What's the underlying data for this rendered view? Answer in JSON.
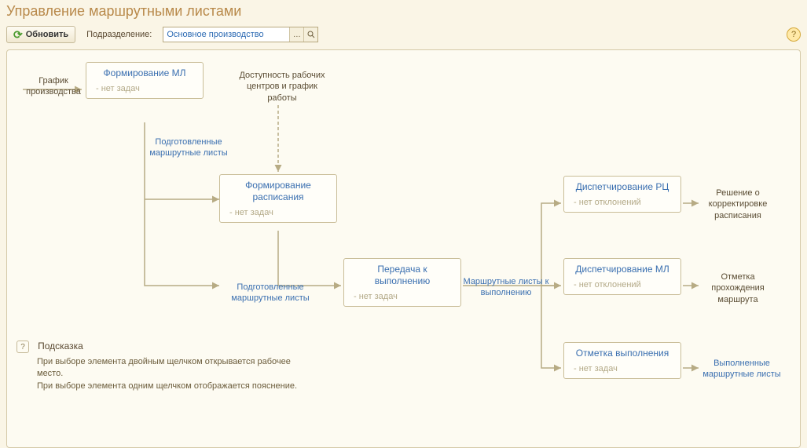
{
  "title": "Управление маршрутными листами",
  "toolbar": {
    "refresh_label": "Обновить",
    "dept_label": "Подразделение:",
    "dept_value": "Основное производство"
  },
  "labels": {
    "schedule_input": "График производства",
    "availability": "Доступность рабочих центров и график работы",
    "prepared_sheets_1": "Подготовленные маршрутные листы",
    "prepared_sheets_2": "Подготовленные маршрутные листы",
    "sheets_to_exec": "Маршрутные листы к выполнению",
    "decision": "Решение о корректировке расписания",
    "route_mark": "Отметка прохождения маршрута",
    "done_sheets": "Выполненные маршрутные листы"
  },
  "nodes": {
    "form_ml": {
      "title": "Формирование МЛ",
      "sub": "- нет задач"
    },
    "form_sched": {
      "title": "Формирование расписания",
      "sub": "- нет задач"
    },
    "transfer": {
      "title": "Передача к выполнению",
      "sub": "- нет задач"
    },
    "disp_rc": {
      "title": "Диспетчирование РЦ",
      "sub": "- нет отклонений"
    },
    "disp_ml": {
      "title": "Диспетчирование МЛ",
      "sub": "- нет отклонений"
    },
    "exec_mark": {
      "title": "Отметка выполнения",
      "sub": "- нет задач"
    }
  },
  "hint": {
    "title": "Подсказка",
    "line1": "При выборе элемента двойным щелчком открывается рабочее место.",
    "line2": "При выборе элемента одним щелчком отображается пояснение."
  }
}
